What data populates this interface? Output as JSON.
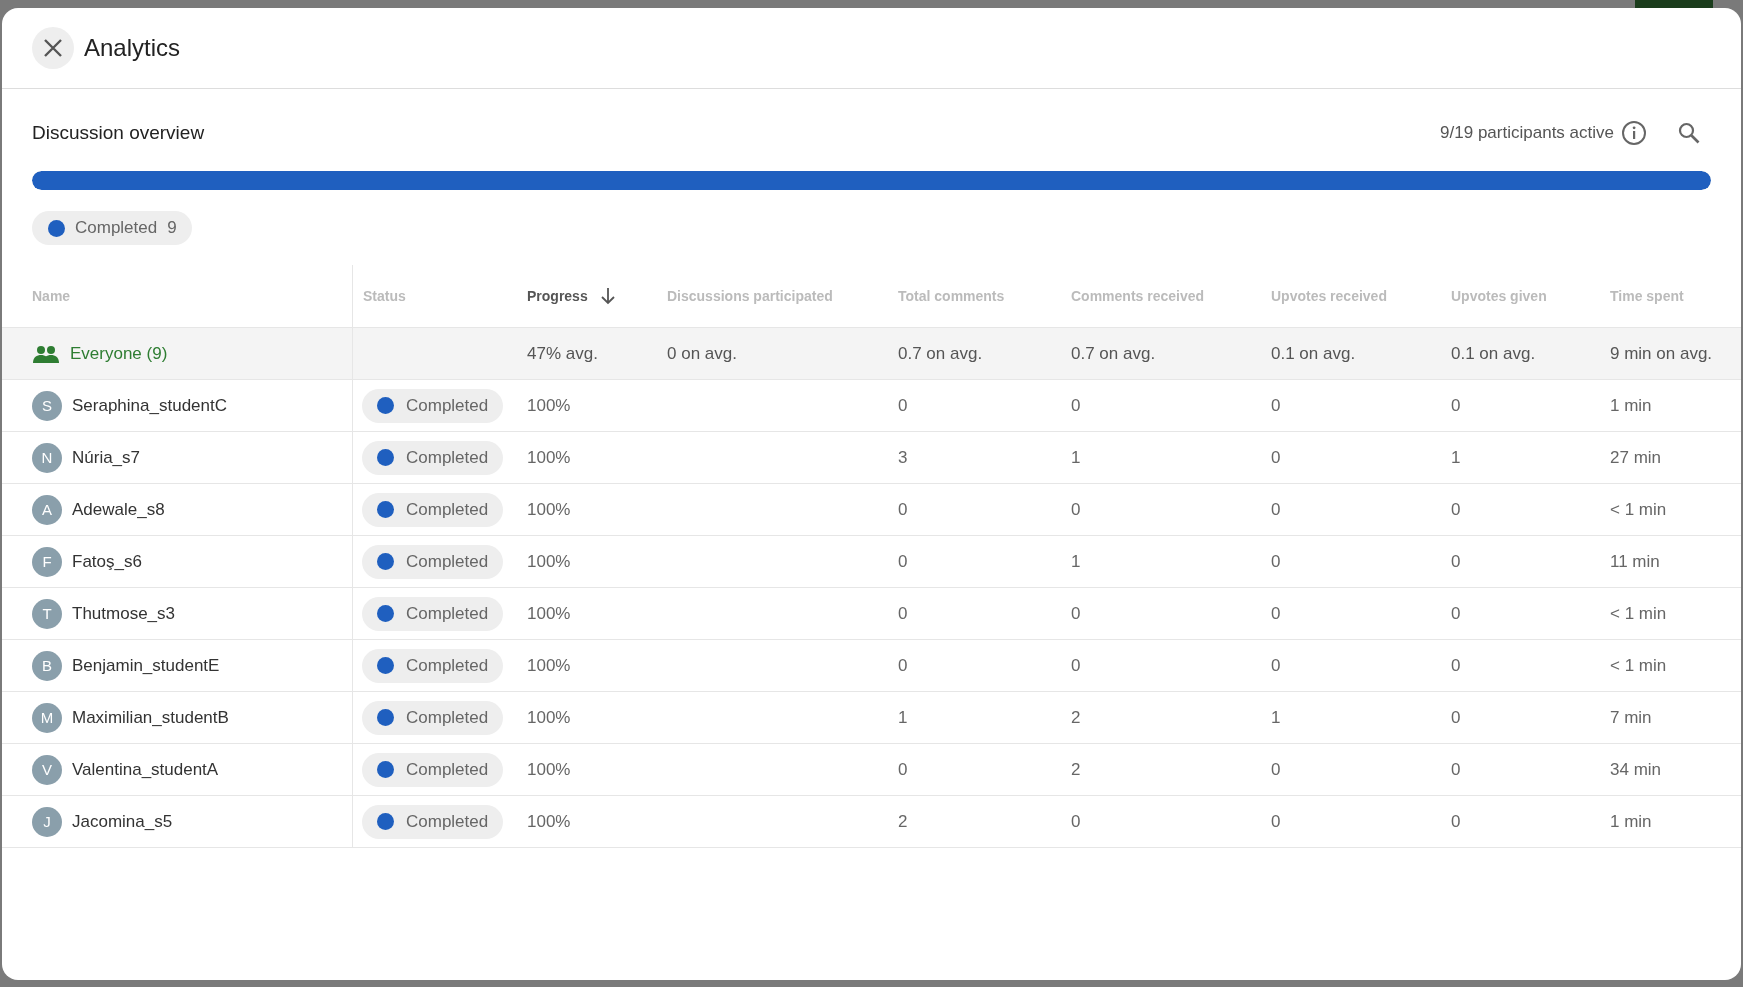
{
  "dialog": {
    "title": "Analytics"
  },
  "overview": {
    "title": "Discussion overview",
    "participants": "9/19 participants active"
  },
  "progress_bar": {
    "level": 1,
    "color": "#1f5fbf"
  },
  "legend": [
    {
      "label": "Completed",
      "count": "9",
      "color": "#1f5fbf"
    }
  ],
  "table": {
    "columns": [
      {
        "label": "Name",
        "sorted": false
      },
      {
        "label": "Status",
        "sorted": false
      },
      {
        "label": "Progress",
        "sorted": true
      },
      {
        "label": "Discussions participated",
        "sorted": false
      },
      {
        "label": "Total comments",
        "sorted": false
      },
      {
        "label": "Comments received",
        "sorted": false
      },
      {
        "label": "Upvotes received",
        "sorted": false
      },
      {
        "label": "Upvotes given",
        "sorted": false
      },
      {
        "label": "Time spent",
        "sorted": false
      }
    ],
    "summary": {
      "name": "Everyone (9)",
      "progress": "47% avg.",
      "discussions": "0 on avg.",
      "total_comments": "0.7 on avg.",
      "comments_received": "0.7 on avg.",
      "upvotes_received": "0.1 on avg.",
      "upvotes_given": "0.1 on avg.",
      "time": "9 min on avg."
    },
    "rows": [
      {
        "initial": "S",
        "name": "Seraphina_studentC",
        "status": {
          "label": "Completed",
          "color": "#1f5fbf"
        },
        "progress": "100%",
        "total_comments": "0",
        "comments_received": "0",
        "upvotes_received": "0",
        "upvotes_given": "0",
        "time": "1 min"
      },
      {
        "initial": "N",
        "name": "Núria_s7",
        "status": {
          "label": "Completed",
          "color": "#1f5fbf"
        },
        "progress": "100%",
        "total_comments": "3",
        "comments_received": "1",
        "upvotes_received": "0",
        "upvotes_given": "1",
        "time": "27 min"
      },
      {
        "initial": "A",
        "name": "Adewale_s8",
        "status": {
          "label": "Completed",
          "color": "#1f5fbf"
        },
        "progress": "100%",
        "total_comments": "0",
        "comments_received": "0",
        "upvotes_received": "0",
        "upvotes_given": "0",
        "time": "< 1 min"
      },
      {
        "initial": "F",
        "name": "Fatoş_s6",
        "status": {
          "label": "Completed",
          "color": "#1f5fbf"
        },
        "progress": "100%",
        "total_comments": "0",
        "comments_received": "1",
        "upvotes_received": "0",
        "upvotes_given": "0",
        "time": "11 min"
      },
      {
        "initial": "T",
        "name": "Thutmose_s3",
        "status": {
          "label": "Completed",
          "color": "#1f5fbf"
        },
        "progress": "100%",
        "total_comments": "0",
        "comments_received": "0",
        "upvotes_received": "0",
        "upvotes_given": "0",
        "time": "< 1 min"
      },
      {
        "initial": "B",
        "name": "Benjamin_studentE",
        "status": {
          "label": "Completed",
          "color": "#1f5fbf"
        },
        "progress": "100%",
        "total_comments": "0",
        "comments_received": "0",
        "upvotes_received": "0",
        "upvotes_given": "0",
        "time": "< 1 min"
      },
      {
        "initial": "M",
        "name": "Maximilian_studentB",
        "status": {
          "label": "Completed",
          "color": "#1f5fbf"
        },
        "progress": "100%",
        "total_comments": "1",
        "comments_received": "2",
        "upvotes_received": "1",
        "upvotes_given": "0",
        "time": "7 min"
      },
      {
        "initial": "V",
        "name": "Valentina_studentA",
        "status": {
          "label": "Completed",
          "color": "#1f5fbf"
        },
        "progress": "100%",
        "total_comments": "0",
        "comments_received": "2",
        "upvotes_received": "0",
        "upvotes_given": "0",
        "time": "34 min"
      },
      {
        "initial": "J",
        "name": "Jacomina_s5",
        "status": {
          "label": "Completed",
          "color": "#1f5fbf"
        },
        "progress": "100%",
        "total_comments": "2",
        "comments_received": "0",
        "upvotes_received": "0",
        "upvotes_given": "0",
        "time": "1 min"
      }
    ]
  }
}
